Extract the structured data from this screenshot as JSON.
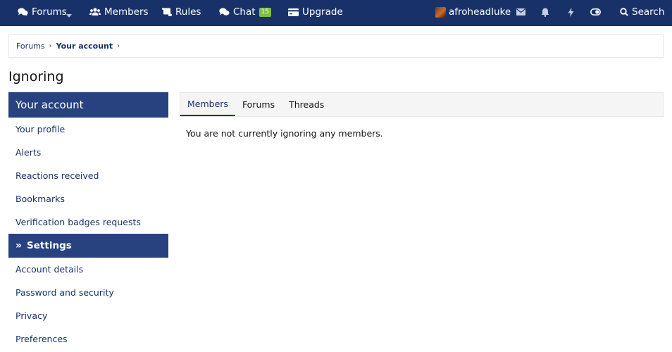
{
  "nav": {
    "forums": "Forums",
    "members": "Members",
    "rules": "Rules",
    "chat": "Chat",
    "chat_count": "15",
    "upgrade": "Upgrade",
    "username": "afroheadluke",
    "search": "Search"
  },
  "breadcrumb": [
    "Forums",
    "Your account"
  ],
  "page_title": "Ignoring",
  "sidebar": {
    "account_header": "Your account",
    "account_items": [
      "Your profile",
      "Alerts",
      "Reactions received",
      "Bookmarks",
      "Verification badges requests"
    ],
    "settings_header": "Settings",
    "settings_items": [
      "Account details",
      "Password and security",
      "Privacy",
      "Preferences"
    ]
  },
  "tabs": [
    "Members",
    "Forums",
    "Threads"
  ],
  "content": {
    "message": "You are not currently ignoring any members."
  },
  "colors": {
    "nav_bg": "#183269",
    "sidebar_header_bg": "#27427e",
    "link": "#183269",
    "chat_badge": "#7ec043"
  }
}
